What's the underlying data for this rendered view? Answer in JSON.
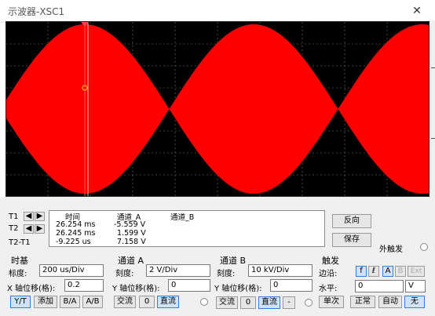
{
  "window": {
    "title": "示波器-XSC1",
    "close_icon": "close-icon"
  },
  "readout": {
    "headers": {
      "time": "时间",
      "a": "通道_A",
      "b": "通道_B"
    },
    "t1": {
      "label": "T1",
      "time": "26.254 ms",
      "a": "-5.559 V",
      "b": ""
    },
    "t2": {
      "label": "T2",
      "time": "26.245 ms",
      "a": "1.599 V",
      "b": ""
    },
    "diff": {
      "label": "T2-T1",
      "time": "-9.225 us",
      "a": "7.158 V",
      "b": ""
    }
  },
  "buttons": {
    "reverse": "反向",
    "save": "保存",
    "ext_trigger": "外触发"
  },
  "timebase": {
    "header": "时基",
    "scale_label": "标度:",
    "scale_value": "200 us/Div",
    "xpos_label": "X 轴位移(格):",
    "xpos_value": "0.2",
    "modes": [
      "Y/T",
      "添加",
      "B/A",
      "A/B"
    ]
  },
  "channel_a": {
    "header": "通道 A",
    "scale_label": "刻度:",
    "scale_value": "2  V/Div",
    "ypos_label": "Y 轴位移(格):",
    "ypos_value": "0",
    "coupling": [
      "交流",
      "0",
      "直流"
    ]
  },
  "channel_b": {
    "header": "通道 B",
    "scale_label": "刻度:",
    "scale_value": "10 kV/Div",
    "ypos_label": "Y 轴位移(格):",
    "ypos_value": "0",
    "coupling": [
      "交流",
      "0",
      "直流",
      "-"
    ]
  },
  "trigger": {
    "header": "触发",
    "edge_label": "边沿:",
    "edge_buttons": [
      "f",
      "ℓ",
      "A",
      "B",
      "Ext"
    ],
    "level_label": "水平:",
    "level_value": "0",
    "level_unit": "V",
    "modes": [
      "单次",
      "正常",
      "自动",
      "无"
    ]
  },
  "colors": {
    "trace": "#ff0000",
    "screen": "#000000",
    "grid": "#888888",
    "cursor1": "#ff0000",
    "cursor2": "#c0c0c0"
  }
}
